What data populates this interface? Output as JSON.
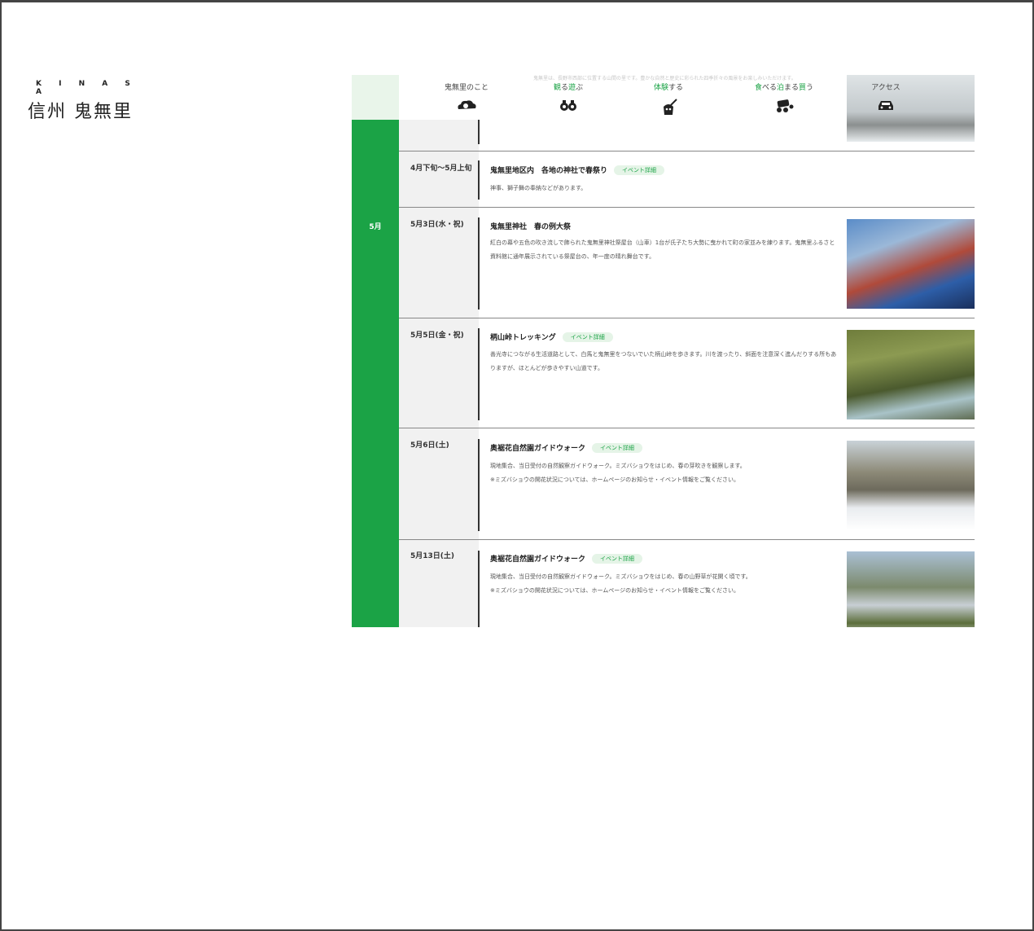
{
  "logo": {
    "romaji": "K I N A S A",
    "name": "信州 鬼無里"
  },
  "nav": {
    "faded_text": "鬼無里は、長野市西部に位置する山間の里です。豊かな自然と歴史に彩られた四季折々の風景をお楽しみいただけます。",
    "items": [
      {
        "label": "鬼無里のこと",
        "icon": "cloud-icon"
      },
      {
        "label_a": "観",
        "label_b": "る",
        "label_c": "遊",
        "label_d": "ぶ",
        "icon": "binoculars-icon"
      },
      {
        "label_a": "体験",
        "label_b": "する",
        "icon": "demon-icon"
      },
      {
        "label_a": "食",
        "label_b": "べる",
        "label_c": "泊",
        "label_d": "まる",
        "label_e": "買",
        "label_f": "う",
        "icon": "basket-icon"
      },
      {
        "label": "アクセス",
        "icon": "car-icon"
      }
    ]
  },
  "events": [
    {
      "month": "",
      "date": "4月下旬〜5月上旬",
      "title": "鬼無里地区内　各地の神社で春祭り",
      "badge": "イベント詳細",
      "desc": "神事、獅子舞の奉納などがあります。",
      "photo": ""
    },
    {
      "month": "5月",
      "date": "5月3日(水・祝)",
      "title": "鬼無里神社　春の例大祭",
      "badge": "",
      "desc": "紅白の幕や五色の吹き流しで飾られた鬼無里神社祭屋台（山車）1台が氏子たち大勢に曳かれて町の家並みを練ります。鬼無里ふるさと資料館に通年展示されている祭屋台の、年一度の晴れ舞台です。",
      "photo": "festival-photo"
    },
    {
      "month": "",
      "date": "5月5日(金・祝)",
      "title": "柄山峠トレッキング",
      "badge": "イベント詳細",
      "desc": "善光寺につながる生活道路として、白馬と鬼無里をつないでいた柄山峠を歩きます。川を渡ったり、斜面を注意深く進んだりする所もありますが、ほとんどが歩きやすい山道です。",
      "photo": "trekking-photo"
    },
    {
      "month": "",
      "date": "5月6日(土)",
      "title": "奥裾花自然園ガイドウォーク",
      "badge": "イベント詳細",
      "desc": "現地集合、当日受付の自然観察ガイドウォーク。ミズバショウをはじめ、春の芽吹きを観察します。\n※ミズバショウの開花状況については、ホームページのお知らせ・イベント情報をご覧ください。",
      "photo": "forest-photo"
    },
    {
      "month": "",
      "date": "5月13日(土)",
      "title": "奥裾花自然園ガイドウォーク",
      "badge": "イベント詳細",
      "desc": "現地集合、当日受付の自然観察ガイドウォーク。ミズバショウをはじめ、春の山野草が花開く頃です。\n※ミズバショウの開花状況については、ホームページのお知らせ・イベント情報をご覧ください。",
      "photo": "skunk-cabbage-photo"
    }
  ]
}
